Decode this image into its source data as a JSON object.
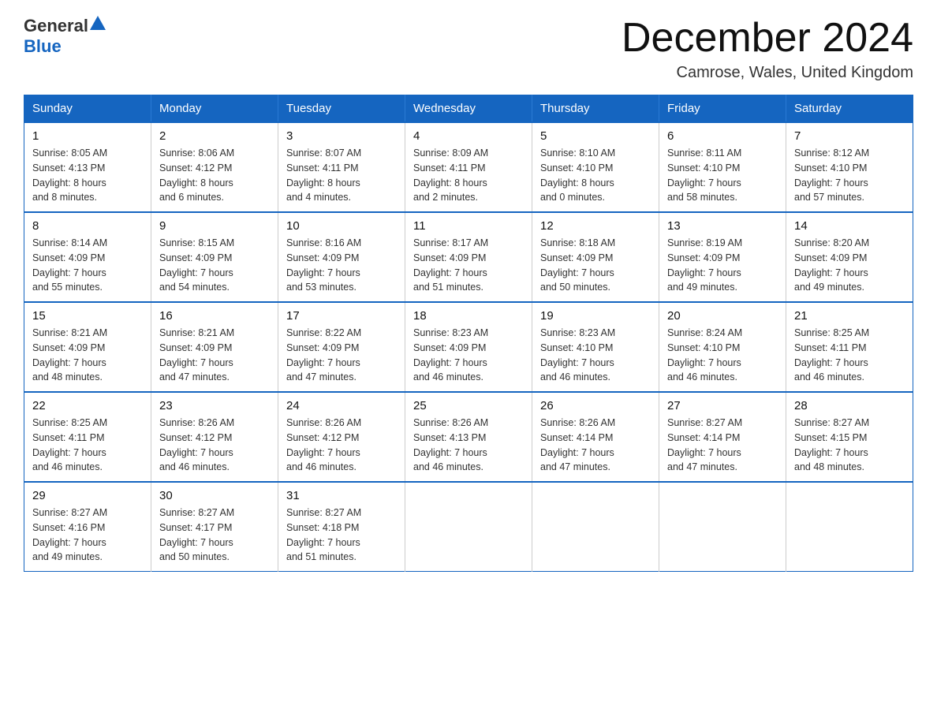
{
  "header": {
    "logo_general": "General",
    "logo_blue": "Blue",
    "month_title": "December 2024",
    "location": "Camrose, Wales, United Kingdom"
  },
  "weekdays": [
    "Sunday",
    "Monday",
    "Tuesday",
    "Wednesday",
    "Thursday",
    "Friday",
    "Saturday"
  ],
  "weeks": [
    [
      {
        "day": "1",
        "sunrise": "8:05 AM",
        "sunset": "4:13 PM",
        "daylight": "8 hours and 8 minutes."
      },
      {
        "day": "2",
        "sunrise": "8:06 AM",
        "sunset": "4:12 PM",
        "daylight": "8 hours and 6 minutes."
      },
      {
        "day": "3",
        "sunrise": "8:07 AM",
        "sunset": "4:11 PM",
        "daylight": "8 hours and 4 minutes."
      },
      {
        "day": "4",
        "sunrise": "8:09 AM",
        "sunset": "4:11 PM",
        "daylight": "8 hours and 2 minutes."
      },
      {
        "day": "5",
        "sunrise": "8:10 AM",
        "sunset": "4:10 PM",
        "daylight": "8 hours and 0 minutes."
      },
      {
        "day": "6",
        "sunrise": "8:11 AM",
        "sunset": "4:10 PM",
        "daylight": "7 hours and 58 minutes."
      },
      {
        "day": "7",
        "sunrise": "8:12 AM",
        "sunset": "4:10 PM",
        "daylight": "7 hours and 57 minutes."
      }
    ],
    [
      {
        "day": "8",
        "sunrise": "8:14 AM",
        "sunset": "4:09 PM",
        "daylight": "7 hours and 55 minutes."
      },
      {
        "day": "9",
        "sunrise": "8:15 AM",
        "sunset": "4:09 PM",
        "daylight": "7 hours and 54 minutes."
      },
      {
        "day": "10",
        "sunrise": "8:16 AM",
        "sunset": "4:09 PM",
        "daylight": "7 hours and 53 minutes."
      },
      {
        "day": "11",
        "sunrise": "8:17 AM",
        "sunset": "4:09 PM",
        "daylight": "7 hours and 51 minutes."
      },
      {
        "day": "12",
        "sunrise": "8:18 AM",
        "sunset": "4:09 PM",
        "daylight": "7 hours and 50 minutes."
      },
      {
        "day": "13",
        "sunrise": "8:19 AM",
        "sunset": "4:09 PM",
        "daylight": "7 hours and 49 minutes."
      },
      {
        "day": "14",
        "sunrise": "8:20 AM",
        "sunset": "4:09 PM",
        "daylight": "7 hours and 49 minutes."
      }
    ],
    [
      {
        "day": "15",
        "sunrise": "8:21 AM",
        "sunset": "4:09 PM",
        "daylight": "7 hours and 48 minutes."
      },
      {
        "day": "16",
        "sunrise": "8:21 AM",
        "sunset": "4:09 PM",
        "daylight": "7 hours and 47 minutes."
      },
      {
        "day": "17",
        "sunrise": "8:22 AM",
        "sunset": "4:09 PM",
        "daylight": "7 hours and 47 minutes."
      },
      {
        "day": "18",
        "sunrise": "8:23 AM",
        "sunset": "4:09 PM",
        "daylight": "7 hours and 46 minutes."
      },
      {
        "day": "19",
        "sunrise": "8:23 AM",
        "sunset": "4:10 PM",
        "daylight": "7 hours and 46 minutes."
      },
      {
        "day": "20",
        "sunrise": "8:24 AM",
        "sunset": "4:10 PM",
        "daylight": "7 hours and 46 minutes."
      },
      {
        "day": "21",
        "sunrise": "8:25 AM",
        "sunset": "4:11 PM",
        "daylight": "7 hours and 46 minutes."
      }
    ],
    [
      {
        "day": "22",
        "sunrise": "8:25 AM",
        "sunset": "4:11 PM",
        "daylight": "7 hours and 46 minutes."
      },
      {
        "day": "23",
        "sunrise": "8:26 AM",
        "sunset": "4:12 PM",
        "daylight": "7 hours and 46 minutes."
      },
      {
        "day": "24",
        "sunrise": "8:26 AM",
        "sunset": "4:12 PM",
        "daylight": "7 hours and 46 minutes."
      },
      {
        "day": "25",
        "sunrise": "8:26 AM",
        "sunset": "4:13 PM",
        "daylight": "7 hours and 46 minutes."
      },
      {
        "day": "26",
        "sunrise": "8:26 AM",
        "sunset": "4:14 PM",
        "daylight": "7 hours and 47 minutes."
      },
      {
        "day": "27",
        "sunrise": "8:27 AM",
        "sunset": "4:14 PM",
        "daylight": "7 hours and 47 minutes."
      },
      {
        "day": "28",
        "sunrise": "8:27 AM",
        "sunset": "4:15 PM",
        "daylight": "7 hours and 48 minutes."
      }
    ],
    [
      {
        "day": "29",
        "sunrise": "8:27 AM",
        "sunset": "4:16 PM",
        "daylight": "7 hours and 49 minutes."
      },
      {
        "day": "30",
        "sunrise": "8:27 AM",
        "sunset": "4:17 PM",
        "daylight": "7 hours and 50 minutes."
      },
      {
        "day": "31",
        "sunrise": "8:27 AM",
        "sunset": "4:18 PM",
        "daylight": "7 hours and 51 minutes."
      },
      null,
      null,
      null,
      null
    ]
  ]
}
